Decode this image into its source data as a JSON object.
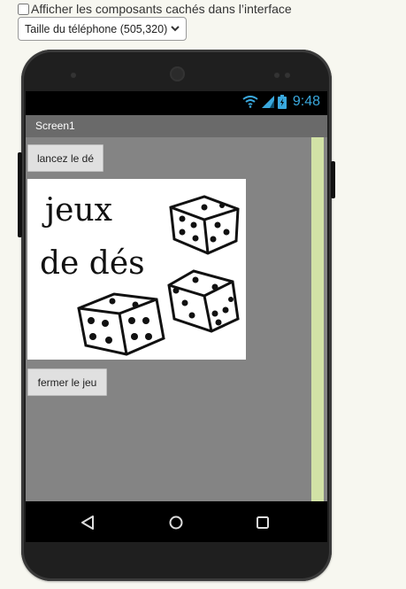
{
  "options": {
    "show_hidden_label": "Afficher les composants cachés dans l’interface",
    "phone_size_selected": "Taille du téléphone (505,320)"
  },
  "status_bar": {
    "time": "9:48"
  },
  "screen": {
    "title": "Screen1",
    "roll_button_label": "lancez le dé",
    "close_button_label": "fermer le jeu",
    "dice_image_text_line1": "jeux",
    "dice_image_text_line2": "de dés"
  },
  "colors": {
    "accent_blue": "#3aa8dd",
    "scrollbar_green": "#d2e2a6",
    "screen_gray": "#848484"
  },
  "icons": [
    "wifi-icon",
    "signal-icon",
    "battery-icon",
    "back-icon",
    "home-icon",
    "recents-icon",
    "chevron-down-icon"
  ]
}
